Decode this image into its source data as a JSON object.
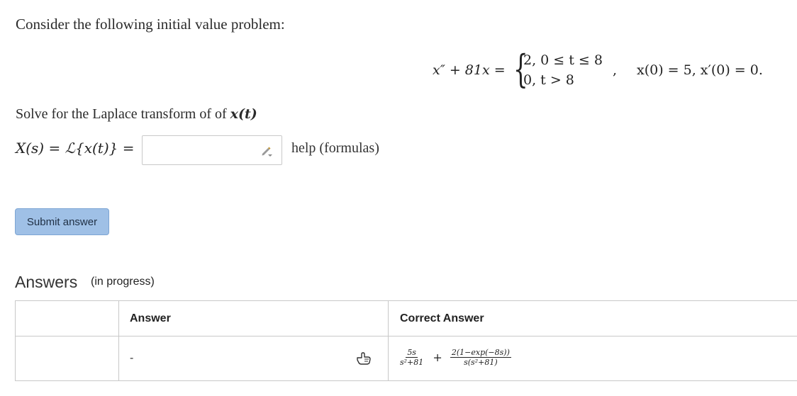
{
  "problem": {
    "prompt": "Consider the following initial value problem:",
    "lhs": "x″ + 81x =",
    "case1": "2,   0 ≤ t ≤ 8",
    "case2": "0,   t > 8",
    "comma": ",",
    "initial_conditions": "x(0) = 5,   x′(0) = 0."
  },
  "solve": {
    "text": "Solve for the Laplace transform of of ",
    "var": "x(t)"
  },
  "input": {
    "label": "X(s) = ℒ{x(t)} =",
    "value": "",
    "placeholder": ""
  },
  "help_link": "help (formulas)",
  "submit_label": "Submit answer",
  "answers": {
    "title": "Answers",
    "status": "(in progress)",
    "headers": [
      "",
      "Answer",
      "Correct Answer"
    ],
    "row": {
      "answer": "-",
      "correct": {
        "term1_num": "5s",
        "term1_den": "s²+81",
        "plus": "+",
        "term2_num": "2(1−exp(−8s))",
        "term2_den": "s(s²+81)"
      }
    }
  },
  "icons": {
    "pencil": "pencil-edit-icon",
    "hand": "pointing-hand-icon"
  }
}
